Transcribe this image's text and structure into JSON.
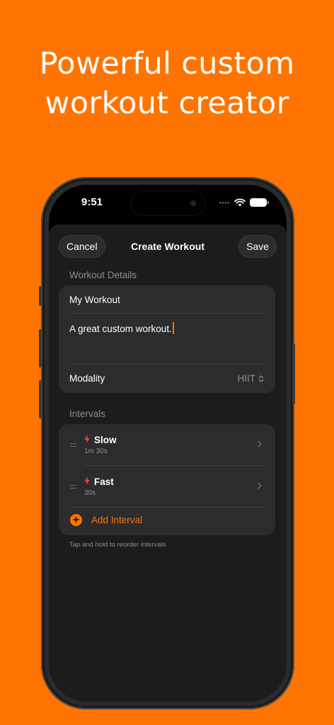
{
  "promo": {
    "headline_line1": "Powerful custom",
    "headline_line2": "workout creator"
  },
  "status_bar": {
    "time": "9:51",
    "signal_icon": "cellular-dots-icon",
    "wifi_icon": "wifi-icon",
    "battery_icon": "battery-icon"
  },
  "nav": {
    "cancel_label": "Cancel",
    "title": "Create Workout",
    "save_label": "Save"
  },
  "details": {
    "section_label": "Workout Details",
    "name_value": "My Workout",
    "description_value": "A great custom workout.",
    "modality_label": "Modality",
    "modality_value": "HIIT"
  },
  "intervals": {
    "section_label": "Intervals",
    "items": [
      {
        "name": "Slow",
        "duration": "1m 30s",
        "icon": "bolt-icon"
      },
      {
        "name": "Fast",
        "duration": "30s",
        "icon": "bolt-icon"
      }
    ],
    "add_label": "Add Interval",
    "footer_note": "Tap and hold to reorder intervals"
  },
  "colors": {
    "accent": "#FF7400",
    "background": "#FF7400",
    "sheet": "#1C1C1E",
    "card": "#2C2C2E",
    "bolt": "#FF453A"
  }
}
